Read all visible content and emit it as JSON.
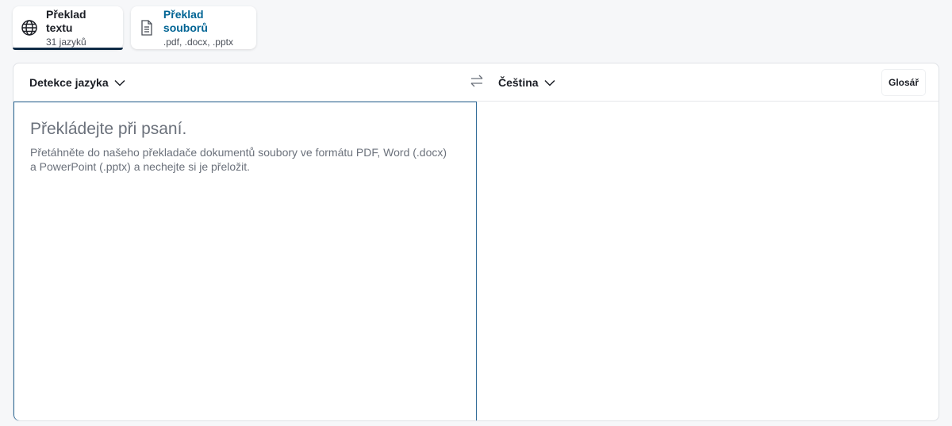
{
  "tabs": [
    {
      "title": "Překlad textu",
      "sub": "31 jazyků",
      "active": true,
      "icon": "globe-icon"
    },
    {
      "title": "Překlad souborů",
      "sub": ".pdf, .docx, .pptx",
      "active": false,
      "icon": "document-icon"
    }
  ],
  "translator": {
    "source_language": "Detekce jazyka",
    "target_language": "Čeština",
    "glossary_label": "Glosář",
    "swap_icon": "swap-icon",
    "source_placeholder_title": "Překládejte při psaní.",
    "source_placeholder_desc": "Přetáhněte do našeho překladače dokumentů soubory ve formátu PDF, Word (.docx) a PowerPoint (.pptx) a nechejte si je přeložit."
  },
  "colors": {
    "accent": "#0f2b46",
    "link": "#006494",
    "focus_border": "#2f6a97",
    "muted_text": "#6b717b"
  }
}
